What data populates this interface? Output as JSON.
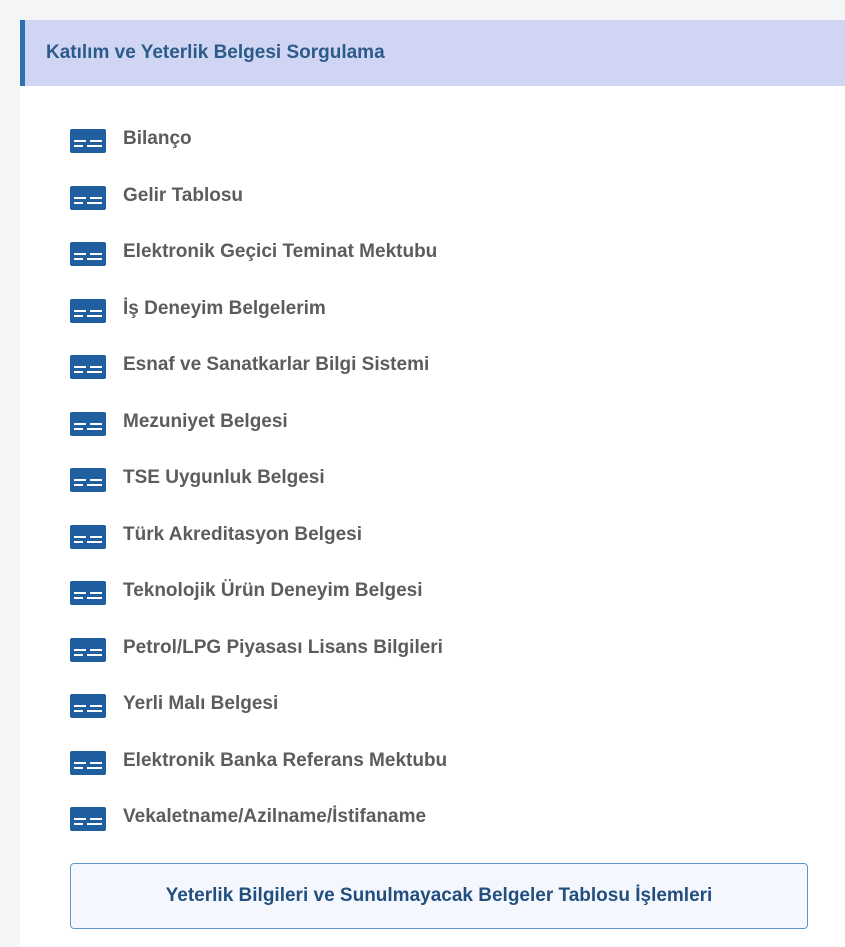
{
  "panel": {
    "title": "Katılım ve Yeterlik Belgesi Sorgulama",
    "accent_color": "#2e6dae",
    "header_background": "#d0d5f3"
  },
  "menu": {
    "icon": "document-card-icon",
    "icon_color": "#1f5f9f",
    "items": [
      {
        "label": "Bilanço"
      },
      {
        "label": "Gelir Tablosu"
      },
      {
        "label": "Elektronik Geçici Teminat Mektubu"
      },
      {
        "label": "İş Deneyim Belgelerim"
      },
      {
        "label": "Esnaf ve Sanatkarlar Bilgi Sistemi"
      },
      {
        "label": "Mezuniyet Belgesi"
      },
      {
        "label": "TSE Uygunluk Belgesi"
      },
      {
        "label": "Türk Akreditasyon Belgesi"
      },
      {
        "label": "Teknolojik Ürün Deneyim Belgesi"
      },
      {
        "label": "Petrol/LPG Piyasası Lisans Bilgileri"
      },
      {
        "label": "Yerli Malı Belgesi"
      },
      {
        "label": "Elektronik Banka Referans Mektubu"
      },
      {
        "label": "Vekaletname/Azilname/İstifaname"
      }
    ]
  },
  "bottom_button": {
    "label": "Yeterlik Bilgileri ve Sunulmayacak Belgeler Tablosu İşlemleri"
  }
}
